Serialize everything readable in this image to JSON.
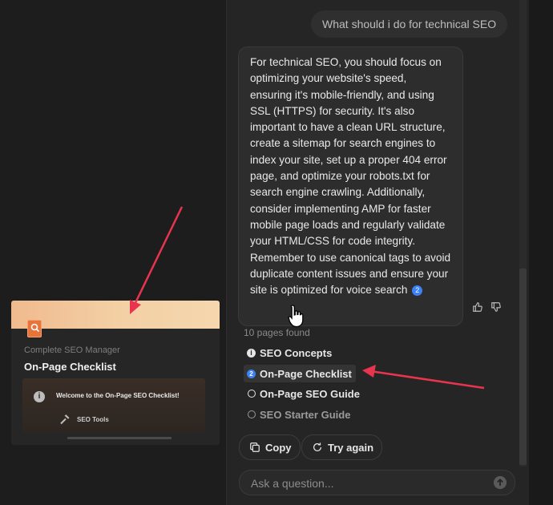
{
  "chat": {
    "user_message": "What should i do for technical SEO",
    "assistant_message": "For technical SEO, you should focus on optimizing your website's speed, ensuring it's mobile-friendly, and using SSL (HTTPS) for security. It's also important to have a clean URL structure, create a sitemap for search engines to index your site, set up a proper 404 error page, and optimize your robots.txt for search engine crawling. Additionally, consider implementing AMP for faster mobile page loads and regularly validate your HTML/CSS for code integrity. Remember to use canonical tags to avoid duplicate content issues and ensure your site is optimized for voice search",
    "citation_number": "2",
    "pages_found_label": "10 pages found",
    "pages": [
      {
        "label": "SEO Concepts",
        "icon": "info-icon"
      },
      {
        "label": "On-Page Checklist",
        "icon": "number-badge",
        "badge": "2",
        "active": true
      },
      {
        "label": "On-Page SEO Guide",
        "icon": "circle-icon"
      },
      {
        "label": "SEO Starter Guide",
        "icon": "circle-icon"
      }
    ],
    "copy_label": "Copy",
    "try_again_label": "Try again",
    "ask_placeholder": "Ask a question..."
  },
  "preview_card": {
    "subtitle": "Complete SEO Manager",
    "title": "On-Page Checklist",
    "welcome": "Welcome to the On-Page SEO Checklist!",
    "tools_label": "SEO Tools"
  },
  "colors": {
    "accent": "#3b82f6",
    "annotation_arrow": "#e8344e",
    "banner_start": "#f0ba8e",
    "banner_end": "#f5d7ae"
  }
}
